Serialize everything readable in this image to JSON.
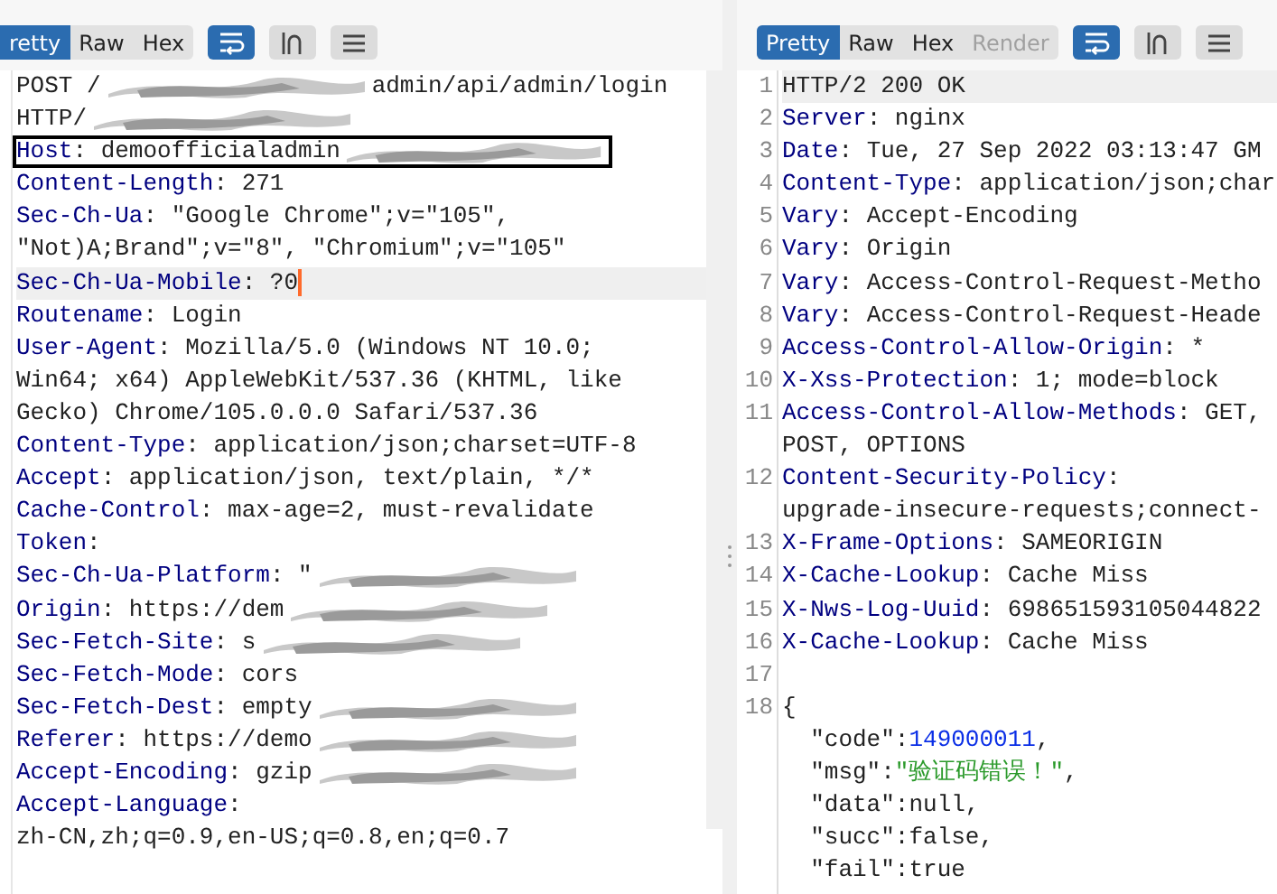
{
  "request": {
    "tabs": [
      {
        "label": "retty",
        "selected": true,
        "disabled": false
      },
      {
        "label": "Raw",
        "selected": false,
        "disabled": false
      },
      {
        "label": "Hex",
        "selected": false,
        "disabled": false
      }
    ],
    "tools": [
      {
        "kind": "wrap",
        "on": true
      },
      {
        "kind": "newline",
        "on": false
      },
      {
        "kind": "menu",
        "on": false
      }
    ],
    "rows": [
      {
        "tokens": [
          {
            "t": "POST /",
            "kind": "plain"
          }
        ],
        "redacted": true,
        "after": [
          {
            "t": "admin/api/admin/login",
            "kind": "plain"
          }
        ]
      },
      {
        "tokens": [
          {
            "t": "HTTP/",
            "kind": "plain"
          }
        ],
        "redacted": true
      },
      {
        "tokens": [
          {
            "t": "Host",
            "kind": "key"
          },
          {
            "t": ": demoofficialadmin",
            "kind": "plain"
          }
        ],
        "boxed": true,
        "redacted": true
      },
      {
        "tokens": [
          {
            "t": "Content-Length",
            "kind": "key"
          },
          {
            "t": ": 271",
            "kind": "plain"
          }
        ]
      },
      {
        "tokens": [
          {
            "t": "Sec-Ch-Ua",
            "kind": "key"
          },
          {
            "t": ": \"Google Chrome\";v=\"105\",",
            "kind": "plain"
          }
        ]
      },
      {
        "tokens": [
          {
            "t": "\"Not)A;Brand\";v=\"8\", \"Chromium\";v=\"105\"",
            "kind": "plain"
          }
        ]
      },
      {
        "tokens": [
          {
            "t": "Sec-Ch-Ua-Mobile",
            "kind": "key"
          },
          {
            "t": ": ?0",
            "kind": "plain"
          }
        ],
        "current": true
      },
      {
        "tokens": [
          {
            "t": "Routename",
            "kind": "key"
          },
          {
            "t": ": Login",
            "kind": "plain"
          }
        ]
      },
      {
        "tokens": [
          {
            "t": "User-Agent",
            "kind": "key"
          },
          {
            "t": ": Mozilla/5.0 (Windows NT 10.0;",
            "kind": "plain"
          }
        ]
      },
      {
        "tokens": [
          {
            "t": "Win64; x64) AppleWebKit/537.36 (KHTML, like",
            "kind": "plain"
          }
        ]
      },
      {
        "tokens": [
          {
            "t": "Gecko) Chrome/105.0.0.0 Safari/537.36",
            "kind": "plain"
          }
        ]
      },
      {
        "tokens": [
          {
            "t": "Content-Type",
            "kind": "key"
          },
          {
            "t": ": application/json;charset=UTF-8",
            "kind": "plain"
          }
        ]
      },
      {
        "tokens": [
          {
            "t": "Accept",
            "kind": "key"
          },
          {
            "t": ": application/json, text/plain, */*",
            "kind": "plain"
          }
        ]
      },
      {
        "tokens": [
          {
            "t": "Cache-Control",
            "kind": "key"
          },
          {
            "t": ": max-age=2, must-revalidate",
            "kind": "plain"
          }
        ]
      },
      {
        "tokens": [
          {
            "t": "Token",
            "kind": "key"
          },
          {
            "t": ":",
            "kind": "plain"
          }
        ]
      },
      {
        "tokens": [
          {
            "t": "Sec-Ch-Ua-Platform",
            "kind": "key"
          },
          {
            "t": ": \"",
            "kind": "plain"
          }
        ],
        "redacted": true
      },
      {
        "tokens": [
          {
            "t": "Origin",
            "kind": "key"
          },
          {
            "t": ": https://dem",
            "kind": "plain"
          }
        ],
        "redacted": true
      },
      {
        "tokens": [
          {
            "t": "Sec-Fetch-Site",
            "kind": "key"
          },
          {
            "t": ": s",
            "kind": "plain"
          }
        ],
        "redacted": true
      },
      {
        "tokens": [
          {
            "t": "Sec-Fetch-Mode",
            "kind": "key"
          },
          {
            "t": ": cors",
            "kind": "plain"
          }
        ]
      },
      {
        "tokens": [
          {
            "t": "Sec-Fetch-Dest",
            "kind": "key"
          },
          {
            "t": ": empty",
            "kind": "plain"
          }
        ],
        "redacted": true
      },
      {
        "tokens": [
          {
            "t": "Referer",
            "kind": "key"
          },
          {
            "t": ": https://demo",
            "kind": "plain"
          }
        ],
        "redacted": true
      },
      {
        "tokens": [
          {
            "t": "Accept-Encoding",
            "kind": "key"
          },
          {
            "t": ": gzip",
            "kind": "plain"
          }
        ],
        "redacted": true
      },
      {
        "tokens": [
          {
            "t": "Accept-Language",
            "kind": "key"
          },
          {
            "t": ":",
            "kind": "plain"
          }
        ]
      },
      {
        "tokens": [
          {
            "t": "zh-CN,zh;q=0.9,en-US;q=0.8,en;q=0.7",
            "kind": "plain"
          }
        ]
      }
    ]
  },
  "response": {
    "tabs": [
      {
        "label": "Pretty",
        "selected": true,
        "disabled": false
      },
      {
        "label": "Raw",
        "selected": false,
        "disabled": false
      },
      {
        "label": "Hex",
        "selected": false,
        "disabled": false
      },
      {
        "label": "Render",
        "selected": false,
        "disabled": true
      }
    ],
    "tools": [
      {
        "kind": "wrap",
        "on": true
      },
      {
        "kind": "newline",
        "on": false
      },
      {
        "kind": "menu",
        "on": false
      }
    ],
    "rows": [
      {
        "number": "1",
        "tokens": [
          {
            "t": "HTTP/2 200 OK",
            "kind": "plain"
          }
        ],
        "current": true
      },
      {
        "number": "2",
        "tokens": [
          {
            "t": "Server",
            "kind": "key"
          },
          {
            "t": ": nginx",
            "kind": "plain"
          }
        ]
      },
      {
        "number": "3",
        "tokens": [
          {
            "t": "Date",
            "kind": "key"
          },
          {
            "t": ": Tue, 27 Sep 2022 03:13:47 GM",
            "kind": "plain"
          }
        ]
      },
      {
        "number": "4",
        "tokens": [
          {
            "t": "Content-Type",
            "kind": "key"
          },
          {
            "t": ": application/json;char",
            "kind": "plain"
          }
        ]
      },
      {
        "number": "5",
        "tokens": [
          {
            "t": "Vary",
            "kind": "key"
          },
          {
            "t": ": Accept-Encoding",
            "kind": "plain"
          }
        ]
      },
      {
        "number": "6",
        "tokens": [
          {
            "t": "Vary",
            "kind": "key"
          },
          {
            "t": ": Origin",
            "kind": "plain"
          }
        ]
      },
      {
        "number": "7",
        "tokens": [
          {
            "t": "Vary",
            "kind": "key"
          },
          {
            "t": ": Access-Control-Request-Metho",
            "kind": "plain"
          }
        ]
      },
      {
        "number": "8",
        "tokens": [
          {
            "t": "Vary",
            "kind": "key"
          },
          {
            "t": ": Access-Control-Request-Heade",
            "kind": "plain"
          }
        ]
      },
      {
        "number": "9",
        "tokens": [
          {
            "t": "Access-Control-Allow-Origin",
            "kind": "key"
          },
          {
            "t": ": *",
            "kind": "plain"
          }
        ]
      },
      {
        "number": "10",
        "tokens": [
          {
            "t": "X-Xss-Protection",
            "kind": "key"
          },
          {
            "t": ": 1; mode=block",
            "kind": "plain"
          }
        ]
      },
      {
        "number": "11",
        "tokens": [
          {
            "t": "Access-Control-Allow-Methods",
            "kind": "key"
          },
          {
            "t": ": GET,",
            "kind": "plain"
          }
        ]
      },
      {
        "tokens": [
          {
            "t": "POST, OPTIONS",
            "kind": "plain"
          }
        ]
      },
      {
        "number": "12",
        "tokens": [
          {
            "t": "Content-Security-Policy",
            "kind": "key"
          },
          {
            "t": ":",
            "kind": "plain"
          }
        ]
      },
      {
        "tokens": [
          {
            "t": "upgrade-insecure-requests;connect-",
            "kind": "plain"
          }
        ]
      },
      {
        "number": "13",
        "tokens": [
          {
            "t": "X-Frame-Options",
            "kind": "key"
          },
          {
            "t": ": SAMEORIGIN",
            "kind": "plain"
          }
        ]
      },
      {
        "number": "14",
        "tokens": [
          {
            "t": "X-Cache-Lookup",
            "kind": "key"
          },
          {
            "t": ": Cache Miss",
            "kind": "plain"
          }
        ]
      },
      {
        "number": "15",
        "tokens": [
          {
            "t": "X-Nws-Log-Uuid",
            "kind": "key"
          },
          {
            "t": ": 698651593105044822",
            "kind": "plain"
          }
        ]
      },
      {
        "number": "16",
        "tokens": [
          {
            "t": "X-Cache-Lookup",
            "kind": "key"
          },
          {
            "t": ": Cache Miss",
            "kind": "plain"
          }
        ]
      },
      {
        "number": "17",
        "tokens": []
      },
      {
        "number": "18",
        "tokens": [
          {
            "t": "{",
            "kind": "plain"
          }
        ]
      },
      {
        "tokens": [
          {
            "t": "  \"code\":",
            "kind": "plain"
          },
          {
            "t": "149000011",
            "kind": "number"
          },
          {
            "t": ",",
            "kind": "plain"
          }
        ]
      },
      {
        "tokens": [
          {
            "t": "  \"msg\":",
            "kind": "plain"
          },
          {
            "t": "\"验证码错误！\"",
            "kind": "string"
          },
          {
            "t": ",",
            "kind": "plain"
          }
        ]
      },
      {
        "tokens": [
          {
            "t": "  \"data\":null,",
            "kind": "plain"
          }
        ]
      },
      {
        "tokens": [
          {
            "t": "  \"succ\":false,",
            "kind": "plain"
          }
        ]
      },
      {
        "tokens": [
          {
            "t": "  \"fail\":true",
            "kind": "plain"
          }
        ]
      }
    ]
  }
}
